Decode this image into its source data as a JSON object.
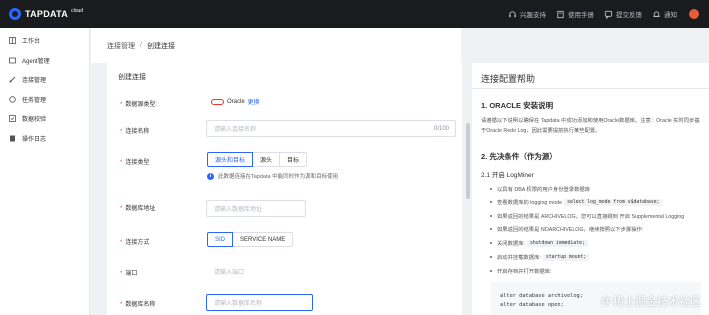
{
  "brand": {
    "name": "TAPDATA",
    "suffix": "cloud"
  },
  "topbar": {
    "items": [
      {
        "label": "兴趣支持",
        "icon": "headset-icon"
      },
      {
        "label": "使用手册",
        "icon": "book-icon"
      },
      {
        "label": "提交反馈",
        "icon": "feedback-icon"
      },
      {
        "label": "通知",
        "icon": "bell-icon"
      }
    ]
  },
  "sidebar": {
    "items": [
      {
        "label": "工作台",
        "icon": "dashboard-icon"
      },
      {
        "label": "Agent管理",
        "icon": "agent-icon"
      },
      {
        "label": "连接管理",
        "icon": "link-icon"
      },
      {
        "label": "任务管理",
        "icon": "task-icon"
      },
      {
        "label": "数据校验",
        "icon": "verify-icon"
      },
      {
        "label": "操作日志",
        "icon": "log-icon"
      }
    ]
  },
  "breadcrumb": {
    "parent": "连接管理",
    "separator": "/",
    "current": "创建连接"
  },
  "form": {
    "title": "创建连接",
    "db_type_label": "数据源类型:",
    "db_type_value": "Oracle",
    "change_label": "更换",
    "name_label": "连接名称",
    "name_placeholder": "请输入连接名称",
    "name_counter": "0/100",
    "conn_type_label": "连接类型",
    "conn_type_options": [
      "源头和目标",
      "源头",
      "目标"
    ],
    "conn_type_hint": "此数据连接在Tapdata 中能同时作为源和目标使用",
    "host_label": "数据库地址",
    "host_placeholder": "请输入数据库地址",
    "conn_mode_label": "连接方式",
    "conn_mode_options": [
      "SID",
      "SERVICE NAME"
    ],
    "port_label": "端口",
    "port_placeholder": "请输入端口",
    "dbname_label": "数据库名称",
    "dbname_placeholder": "请输入数据库名称"
  },
  "help": {
    "title": "连接配置帮助",
    "section1": "1. ORACLE 安装说明",
    "intro_line1": "请遵循以下说明以确保在 Tapdata 中成功添加和使用Oracle数据库。注意：Oracle 实时同步基",
    "intro_line2": "于Oracle Redo Log，因此需要提前执行某些配置。",
    "section2": "2. 先决条件（作为源）",
    "sub1": "2.1 开启 LogMiner",
    "bullets": [
      {
        "text": "以具有 DBA 权限的用户身份登录数据库",
        "code": "",
        "after": ""
      },
      {
        "text": "查看数据库的 logging mode",
        "code": "select log_mode from v$database;",
        "after": ""
      },
      {
        "text": "如果返回的结果是 ARCHIVELOG，您可以直接跳到 开启 Supplemental Logging",
        "code": "",
        "after": ""
      },
      {
        "text": "如果返回的结果是 NOARCHIVELOG，继续按照以下步骤操作:",
        "code": "",
        "after": ""
      },
      {
        "text": "关闭数据库:",
        "code": "shutdown immediate;",
        "after": ""
      },
      {
        "text": "启动并挂载数据库:",
        "code": "startup mount;",
        "after": ""
      },
      {
        "text": "开启存档并打开数据库:",
        "code": "",
        "after": ""
      }
    ],
    "code_lines": [
      "alter database archivelog;",
      "alter database open;"
    ]
  },
  "watermark": {
    "at": "@",
    "text": "稀土掘金技术社区"
  },
  "colors": {
    "accent": "#2c65ff",
    "topbar": "#1a1b1f",
    "oracle": "#e8372e"
  }
}
